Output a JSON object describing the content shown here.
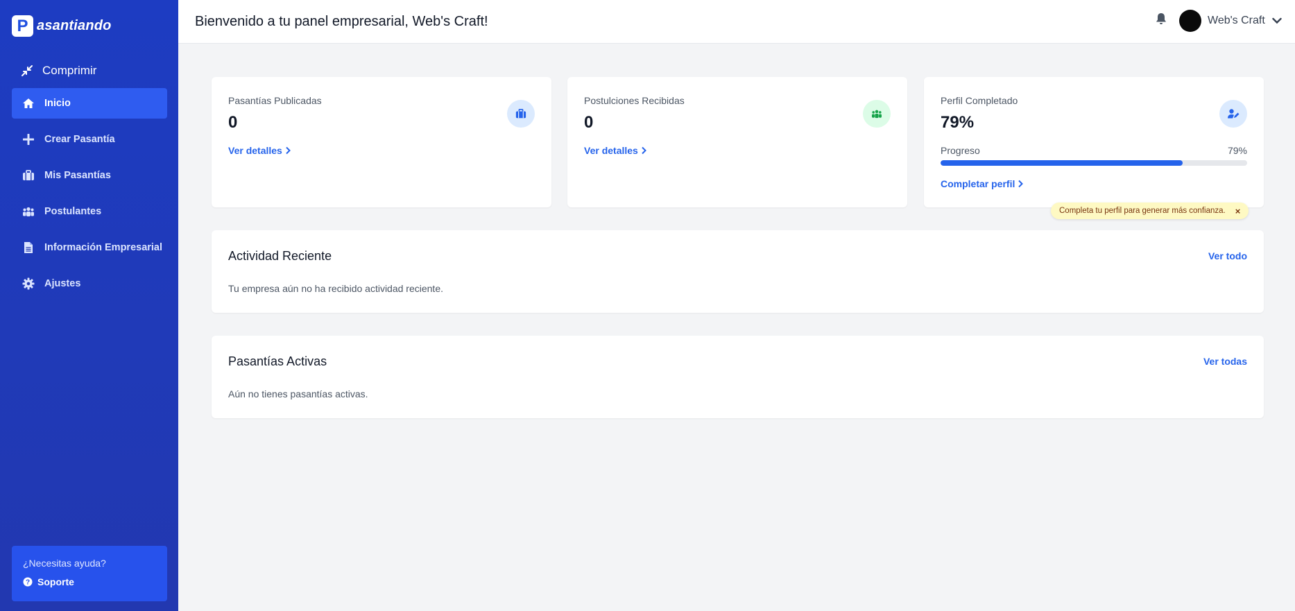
{
  "brand": {
    "mark": "P",
    "name": "asantiando"
  },
  "sidebar": {
    "collapse_label": "Comprimir",
    "items": [
      {
        "label": "Inicio",
        "icon": "home-icon",
        "active": true
      },
      {
        "label": "Crear Pasantía",
        "icon": "plus-icon",
        "active": false
      },
      {
        "label": "Mis Pasantías",
        "icon": "briefcase-icon",
        "active": false
      },
      {
        "label": "Postulantes",
        "icon": "users-icon",
        "active": false
      },
      {
        "label": "Información Empresarial",
        "icon": "file-icon",
        "active": false
      },
      {
        "label": "Ajustes",
        "icon": "gear-icon",
        "active": false
      }
    ],
    "help": {
      "question": "¿Necesitas ayuda?",
      "link": "Soporte"
    }
  },
  "header": {
    "welcome": "Bienvenido a tu panel empresarial, Web's Craft!",
    "user_name": "Web's Craft"
  },
  "stats": [
    {
      "label": "Pasantías Publicadas",
      "value": "0",
      "link": "Ver detalles"
    },
    {
      "label": "Postulciones Recibidas",
      "value": "0",
      "link": "Ver detalles"
    },
    {
      "label": "Perfil Completado",
      "value": "79%",
      "progress_label": "Progreso",
      "progress_pct": "79%",
      "progress_value": 0.79,
      "link": "Completar perfil"
    }
  ],
  "tooltip": {
    "text": "Completa tu perfil para generar más confianza.",
    "close": "×"
  },
  "recent": {
    "title": "Actividad Reciente",
    "link": "Ver todo",
    "empty": "Tu empresa aún no ha recibido actividad reciente."
  },
  "active": {
    "title": "Pasantías Activas",
    "link": "Ver todas",
    "empty": "Aún no tienes pasantías activas."
  },
  "colors": {
    "sidebar": "#1d3cc2",
    "active_nav": "#2f5cf0",
    "accent": "#2563eb",
    "tooltip_bg": "#fef9c3"
  }
}
